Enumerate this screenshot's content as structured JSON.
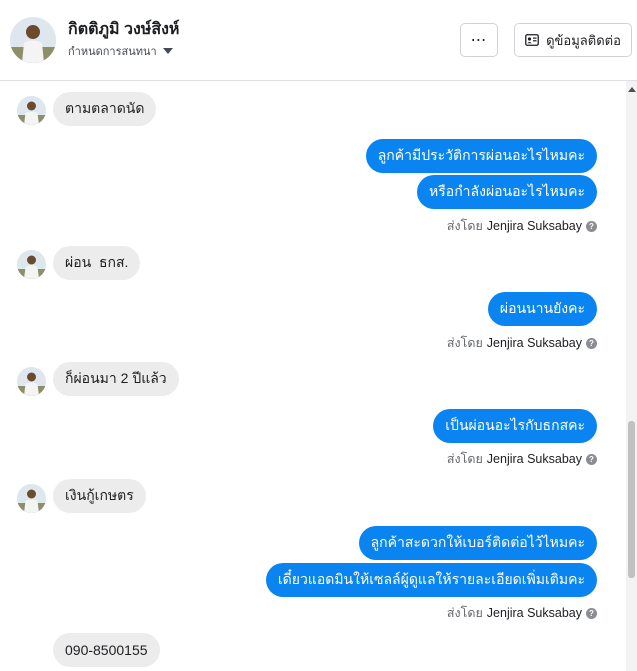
{
  "header": {
    "name": "กิตติภูมิ วงษ์สิงห์",
    "subtitle": "กำหนดการสนทนา",
    "more_label": "⋯",
    "contact_label": "ดูข้อมูลติดต่อ"
  },
  "sent_by": {
    "prefix": "ส่งโดย",
    "agent": "Jenjira Suksabay"
  },
  "messages": {
    "m1": "ตามตลาดนัด",
    "m2": "ลูกค้ามีประวัติการผ่อนอะไรไหมคะ",
    "m3": "หรือกำลังผ่อนอะไรไหมคะ",
    "m4": "ผ่อน  ธกส.",
    "m5": "ผ่อนนานยังคะ",
    "m6": "ก็ผ่อนมา 2 ปีแล้ว",
    "m7": "เป็นผ่อนอะไรกับธกสคะ",
    "m8": "เงินกู้เกษตร",
    "m9": "ลูกค้าสะดวกให้เบอร์ติดต่อไว้ไหมคะ",
    "m10": "เดี๋ยวแอดมินให้เซลล์ผู้ดูแลให้รายละเอียดเพิ่มเติมคะ",
    "m11": "090-8500155"
  },
  "colors": {
    "outgoing": "#0a84f0",
    "incoming": "#ececec"
  }
}
